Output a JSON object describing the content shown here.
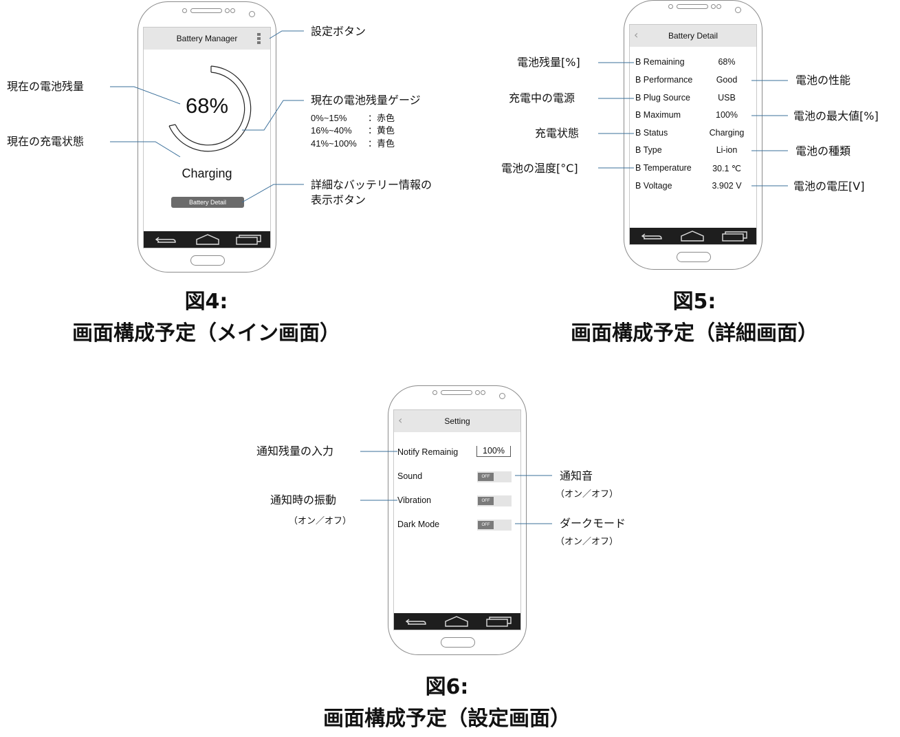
{
  "fig4": {
    "app_title": "Battery Manager",
    "percent": "68%",
    "status": "Charging",
    "button": "Battery Detail",
    "labels": {
      "settings": "設定ボタン",
      "gauge": "現在の電池残量ゲージ",
      "gauge_ranges": [
        {
          "range": "0%~15%",
          "color": "：赤色"
        },
        {
          "range": "16%~40%",
          "color": "：黄色"
        },
        {
          "range": "41%~100%",
          "color": "：青色"
        }
      ],
      "remaining": "現在の電池残量",
      "charge_state": "現在の充電状態",
      "detail_button_1": "詳細なバッテリー情報の",
      "detail_button_2": "表示ボタン"
    },
    "caption_1": "図4:",
    "caption_2": "画面構成予定（メイン画面）"
  },
  "fig5": {
    "app_title": "Battery Detail",
    "rows": [
      {
        "label": "B Remaining",
        "value": "68%"
      },
      {
        "label": "B Performance",
        "value": "Good"
      },
      {
        "label": "B Plug Source",
        "value": "USB"
      },
      {
        "label": "B Maximum",
        "value": "100%"
      },
      {
        "label": "B Status",
        "value": "Charging"
      },
      {
        "label": "B Type",
        "value": "Li-ion"
      },
      {
        "label": "B Temperature",
        "value": "30.1 ℃"
      },
      {
        "label": "B Voltage",
        "value": "3.902 V"
      }
    ],
    "left_labels": {
      "remaining": "電池残量[%]",
      "plug_source": "充電中の電源",
      "status": "充電状態",
      "temperature": "電池の温度[°C]"
    },
    "right_labels": {
      "performance": "電池の性能",
      "maximum": "電池の最大値[%]",
      "type": "電池の種類",
      "voltage": "電池の電圧[V]"
    },
    "caption_1": "図5:",
    "caption_2": "画面構成予定（詳細画面）"
  },
  "fig6": {
    "app_title": "Setting",
    "notify_label": "Notify Remainig",
    "notify_value": "100%",
    "sound_label": "Sound",
    "vibration_label": "Vibration",
    "dark_label": "Dark Mode",
    "toggle_text": "OFF",
    "labels": {
      "notify": "通知残量の入力",
      "sound": "通知音",
      "sound_sub": "（オン／オフ）",
      "vibration": "通知時の振動",
      "vibration_sub": "（オン／オフ）",
      "dark": "ダークモード",
      "dark_sub": "（オン／オフ）"
    },
    "caption_1": "図6:",
    "caption_2": "画面構成予定（設定画面）"
  },
  "colors": {
    "leader": "#3a6f9a",
    "appbar": "#e6e6e6",
    "navbar": "#1e1e1e",
    "button": "#6b6b6b"
  }
}
